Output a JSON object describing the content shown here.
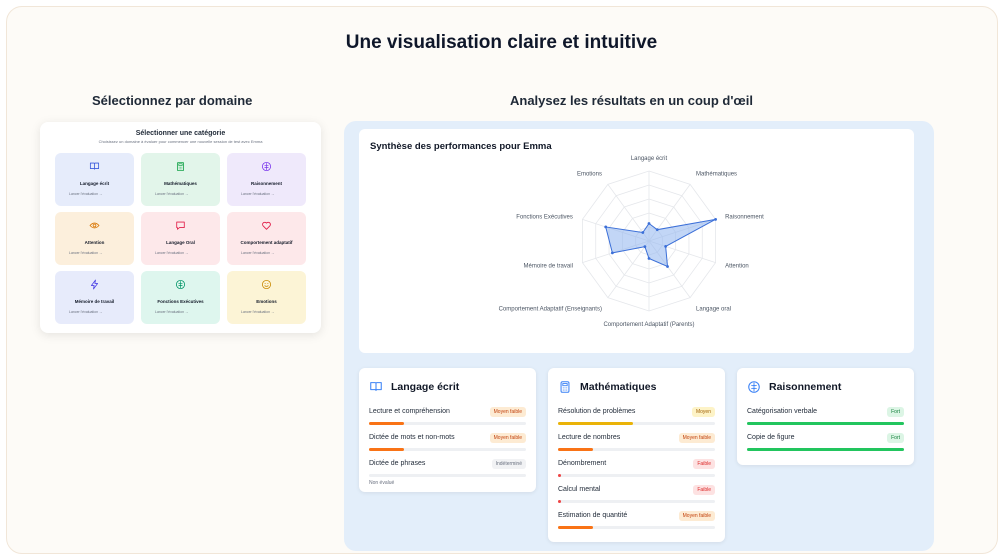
{
  "main_title": "Une visualisation claire et intuitive",
  "left_subtitle": "Sélectionnez par domaine",
  "right_subtitle": "Analysez les résultats en un coup d'œil",
  "selector": {
    "title": "Sélectionner une catégorie",
    "subtitle": "Choisissez un domaine à évaluer pour commencer une nouvelle session de test avec Emma",
    "categories": [
      {
        "label": "Langage écrit",
        "link": "Lancer l'évaluation →",
        "icon": "book-icon",
        "bg": "#e6ecfb",
        "color": "#3b5bdb"
      },
      {
        "label": "Mathématiques",
        "link": "Lancer l'évaluation →",
        "icon": "calculator-icon",
        "bg": "#e2f5ea",
        "color": "#16a34a"
      },
      {
        "label": "Raisonnement",
        "link": "Lancer l'évaluation →",
        "icon": "brain-icon",
        "bg": "#efe9fb",
        "color": "#7c3aed"
      },
      {
        "label": "Attention",
        "link": "Lancer l'évaluation →",
        "icon": "eye-icon",
        "bg": "#fcefdc",
        "color": "#d97706"
      },
      {
        "label": "Langage Oral",
        "link": "Lancer l'évaluation →",
        "icon": "speech-bubble-icon",
        "bg": "#fde8ea",
        "color": "#e11d48"
      },
      {
        "label": "Comportement adaptatif",
        "link": "Lancer l'évaluation →",
        "icon": "heart-icon",
        "bg": "#fde8ea",
        "color": "#e11d48"
      },
      {
        "label": "Mémoire de travail",
        "link": "Lancer l'évaluation →",
        "icon": "lightning-icon",
        "bg": "#e7ebfb",
        "color": "#4f46e5"
      },
      {
        "label": "Fonctions Exécutives",
        "link": "Lancer l'évaluation →",
        "icon": "brain-icon",
        "bg": "#def6ee",
        "color": "#059669"
      },
      {
        "label": "Emotions",
        "link": "Lancer l'évaluation →",
        "icon": "smile-icon",
        "bg": "#fcf4d6",
        "color": "#ca8a04"
      }
    ]
  },
  "radar": {
    "title": "Synthèse des performances pour Emma",
    "axes": [
      "Langage écrit",
      "Mathématiques",
      "Raisonnement",
      "Attention",
      "Langage oral",
      "Comportement Adaptatif (Parents)",
      "Comportement Adaptatif (Enseignants)",
      "Mémoire de travail",
      "Fonctions Exécutives",
      "Emotions"
    ],
    "levels": 5,
    "values": [
      0.25,
      0.2,
      1.0,
      0.25,
      0.45,
      0.25,
      0.1,
      0.55,
      0.65,
      0.15
    ],
    "fill": "#8fb4ee",
    "stroke": "#3b6fd8"
  },
  "domains": [
    {
      "title": "Langage écrit",
      "icon": "book-icon",
      "icon_color": "#3b82f6",
      "skills": [
        {
          "name": "Lecture et compréhension",
          "badge": "Moyen faible",
          "badge_bg": "#fdebd3",
          "badge_color": "#c2410c",
          "fill": 0.22,
          "fill_color": "#f97316"
        },
        {
          "name": "Dictée de mots et non-mots",
          "badge": "Moyen faible",
          "badge_bg": "#fdebd3",
          "badge_color": "#c2410c",
          "fill": 0.22,
          "fill_color": "#f97316"
        },
        {
          "name": "Dictée de phrases",
          "badge": "Indéterminé",
          "badge_bg": "#f1f2f4",
          "badge_color": "#6b7280",
          "fill": 0,
          "fill_color": "#9ca3af",
          "note": "Non évalué"
        }
      ]
    },
    {
      "title": "Mathématiques",
      "icon": "calculator-icon",
      "icon_color": "#3b82f6",
      "skills": [
        {
          "name": "Résolution de problèmes",
          "badge": "Moyen",
          "badge_bg": "#fdf3c7",
          "badge_color": "#a16207",
          "fill": 0.48,
          "fill_color": "#eab308"
        },
        {
          "name": "Lecture de nombres",
          "badge": "Moyen faible",
          "badge_bg": "#fdebd3",
          "badge_color": "#c2410c",
          "fill": 0.22,
          "fill_color": "#f97316"
        },
        {
          "name": "Dénombrement",
          "badge": "Faible",
          "badge_bg": "#fde2e2",
          "badge_color": "#dc2626",
          "fill": 0.02,
          "fill_color": "#ef4444"
        },
        {
          "name": "Calcul mental",
          "badge": "Faible",
          "badge_bg": "#fde2e2",
          "badge_color": "#dc2626",
          "fill": 0.02,
          "fill_color": "#ef4444"
        },
        {
          "name": "Estimation de quantité",
          "badge": "Moyen faible",
          "badge_bg": "#fdebd3",
          "badge_color": "#c2410c",
          "fill": 0.22,
          "fill_color": "#f97316"
        }
      ]
    },
    {
      "title": "Raisonnement",
      "icon": "brain-icon",
      "icon_color": "#3b82f6",
      "skills": [
        {
          "name": "Catégorisation verbale",
          "badge": "Fort",
          "badge_bg": "#dcf5e5",
          "badge_color": "#15803d",
          "fill": 1.0,
          "fill_color": "#22c55e"
        },
        {
          "name": "Copie de figure",
          "badge": "Fort",
          "badge_bg": "#dcf5e5",
          "badge_color": "#15803d",
          "fill": 1.0,
          "fill_color": "#22c55e"
        }
      ]
    }
  ]
}
